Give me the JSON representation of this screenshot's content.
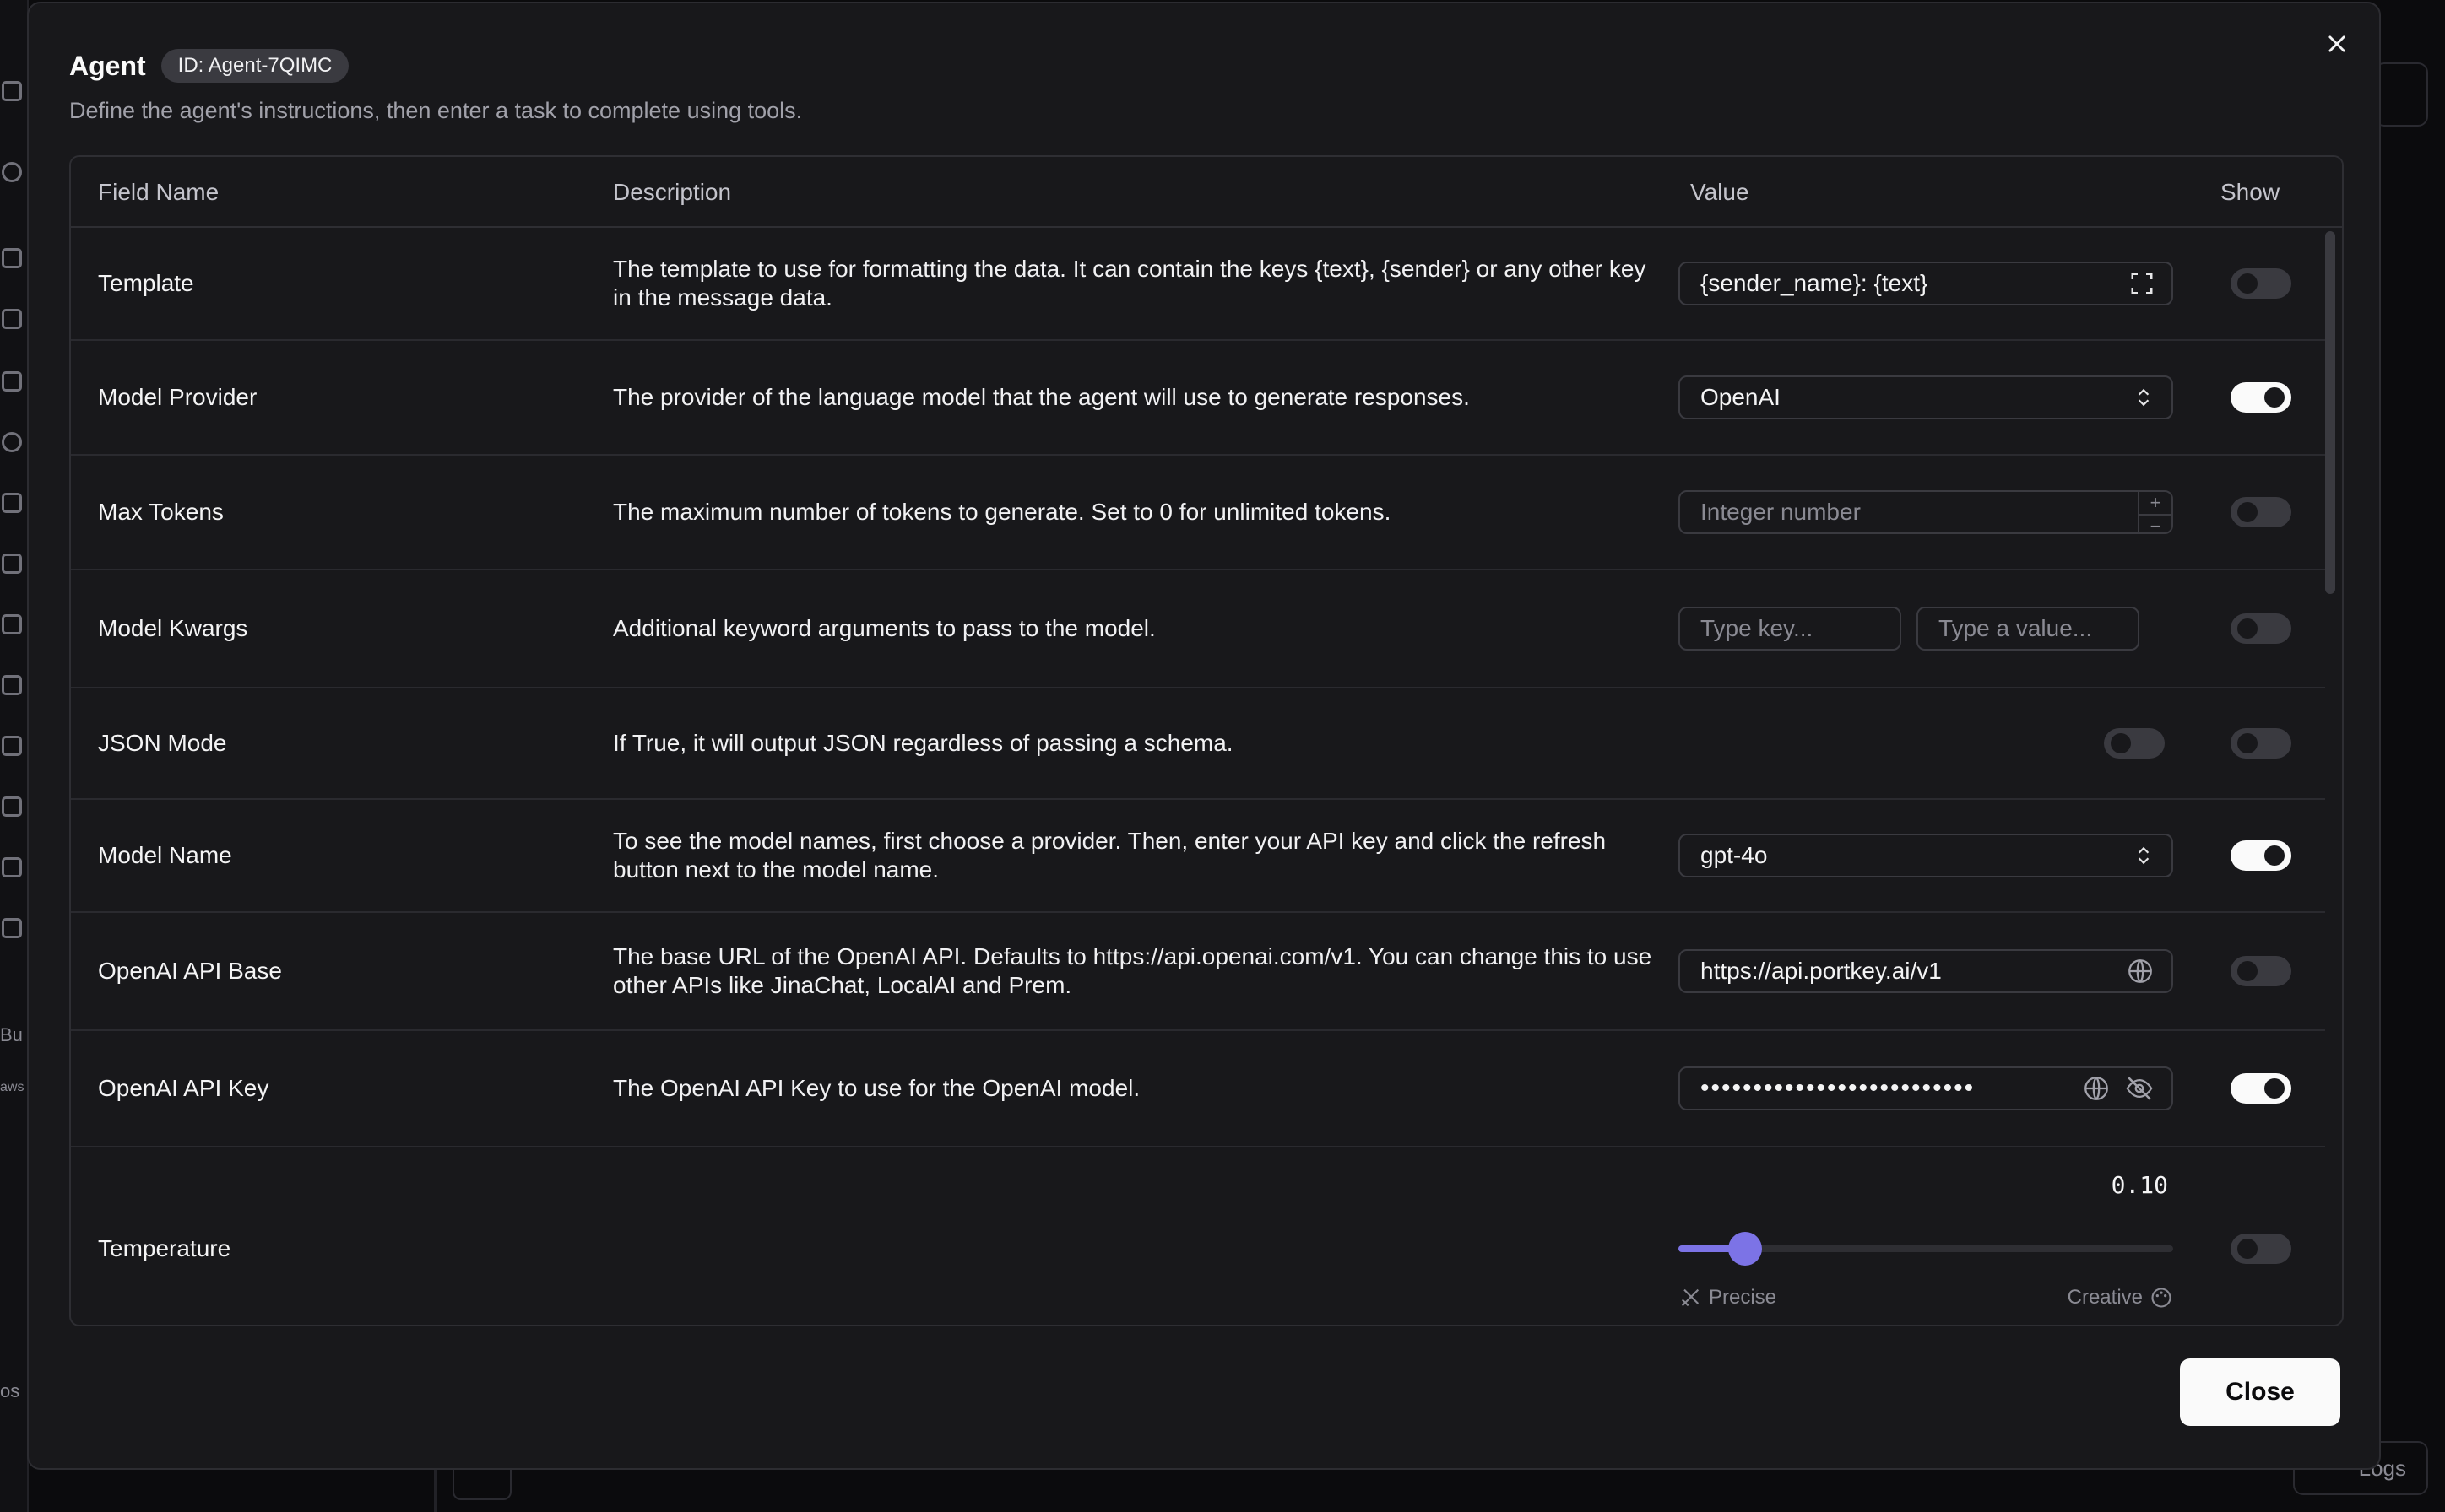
{
  "background": {
    "logs_label": "Logs",
    "sidebar_texts": [
      "Bu",
      "aws",
      "os"
    ]
  },
  "modal": {
    "title": "Agent",
    "id_badge": "ID: Agent-7QIMC",
    "subtitle": "Define the agent's instructions, then enter a task to complete using tools.",
    "close_label": "Close"
  },
  "table": {
    "headers": {
      "field_name": "Field Name",
      "description": "Description",
      "value": "Value",
      "show": "Show"
    },
    "rows": [
      {
        "name": "Template",
        "description": "The template to use for formatting the data. It can contain the keys {text}, {sender} or any other key in the message data.",
        "value": "{sender_name}: {text}",
        "show": false
      },
      {
        "name": "Model Provider",
        "description": "The provider of the language model that the agent will use to generate responses.",
        "value": "OpenAI",
        "show": true
      },
      {
        "name": "Max Tokens",
        "description": "The maximum number of tokens to generate. Set to 0 for unlimited tokens.",
        "placeholder": "Integer number",
        "show": false
      },
      {
        "name": "Model Kwargs",
        "description": "Additional keyword arguments to pass to the model.",
        "key_placeholder": "Type key...",
        "value_placeholder": "Type a value...",
        "show": false
      },
      {
        "name": "JSON Mode",
        "description": "If True, it will output JSON regardless of passing a schema.",
        "value_toggle": false,
        "show": false
      },
      {
        "name": "Model Name",
        "description": "To see the model names, first choose a provider. Then, enter your API key and click the refresh button next to the model name.",
        "value": "gpt-4o",
        "show": true
      },
      {
        "name": "OpenAI API Base",
        "description": "The base URL of the OpenAI API. Defaults to https://api.openai.com/v1. You can change this to use other APIs like JinaChat, LocalAI and Prem.",
        "value": "https://api.portkey.ai/v1",
        "show": false
      },
      {
        "name": "OpenAI API Key",
        "description": "The OpenAI API Key to use for the OpenAI model.",
        "value": "••••••••••••••••••••••••••",
        "show": true
      },
      {
        "name": "Temperature",
        "description": "",
        "value": "0.10",
        "slider_fraction": 0.1,
        "left_label": "Precise",
        "right_label": "Creative",
        "show": false
      }
    ]
  },
  "colors": {
    "accent": "#7c73e6",
    "panel": "#18181b",
    "border": "#2e2e33"
  }
}
